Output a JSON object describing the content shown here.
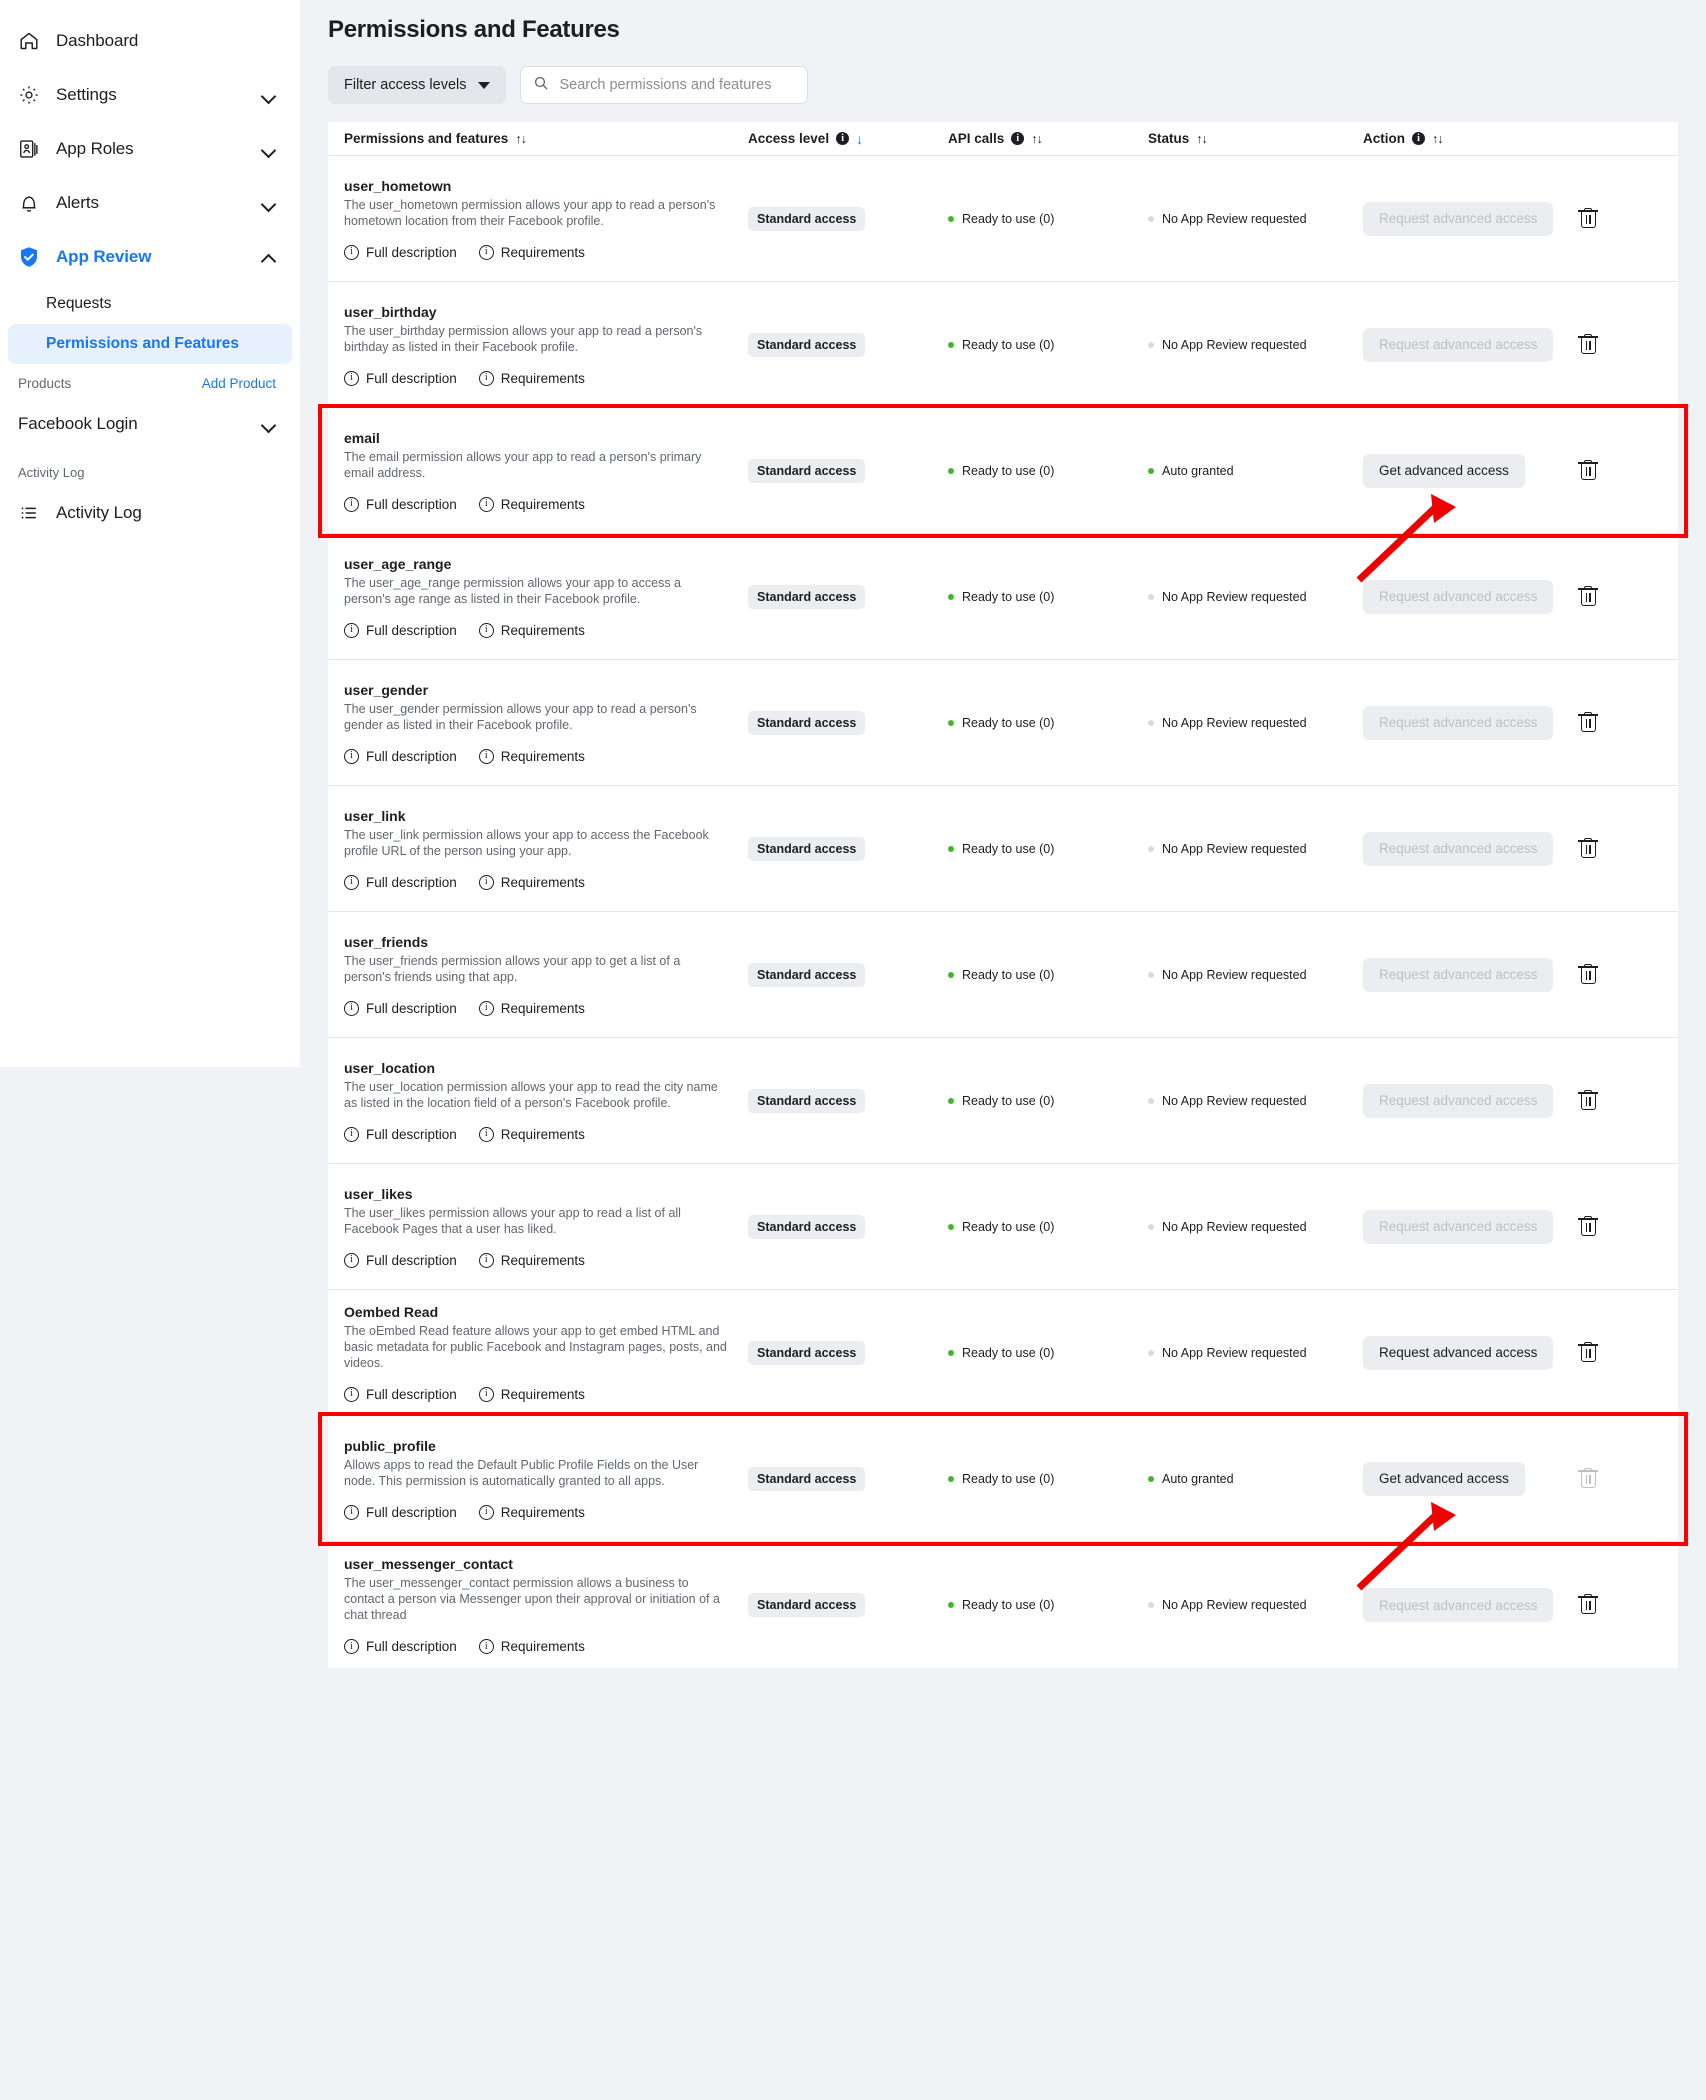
{
  "sidebar": {
    "items": [
      {
        "label": "Dashboard",
        "icon": "home-icon",
        "chevron": "none"
      },
      {
        "label": "Settings",
        "icon": "gear-icon",
        "chevron": "down"
      },
      {
        "label": "App Roles",
        "icon": "app-roles-icon",
        "chevron": "down"
      },
      {
        "label": "Alerts",
        "icon": "bell-icon",
        "chevron": "down"
      },
      {
        "label": "App Review",
        "icon": "shield-check-icon",
        "chevron": "up",
        "active": true
      }
    ],
    "sub_items": [
      {
        "label": "Requests",
        "selected": false
      },
      {
        "label": "Permissions and Features",
        "selected": true
      }
    ],
    "products_label": "Products",
    "add_product_label": "Add Product",
    "product_items": [
      {
        "label": "Facebook Login",
        "chevron": "down"
      }
    ],
    "activity_log_heading": "Activity Log",
    "activity_log_item": {
      "label": "Activity Log",
      "icon": "list-icon"
    }
  },
  "header": {
    "title": "Permissions and Features"
  },
  "toolbar": {
    "filter_label": "Filter access levels",
    "search_placeholder": "Search permissions and features",
    "search_value": ""
  },
  "table": {
    "columns": [
      {
        "label": "Permissions and features",
        "info": false,
        "sort": "updown"
      },
      {
        "label": "Access level",
        "info": true,
        "sort": "down-blue"
      },
      {
        "label": "API calls",
        "info": true,
        "sort": "updown"
      },
      {
        "label": "Status",
        "info": false,
        "sort": "updown"
      },
      {
        "label": "Action",
        "info": true,
        "sort": "updown"
      }
    ],
    "rows": [
      {
        "name": "user_hometown",
        "description": "The user_hometown permission allows your app to read a person's hometown location from their Facebook profile.",
        "access_level": "Standard access",
        "api_calls": "Ready to use (0)",
        "api_dot": "green",
        "status": "No App Review requested",
        "status_dot": "grey",
        "action_label": "Request advanced access",
        "action_enabled": false,
        "trash_enabled": true,
        "highlighted": false
      },
      {
        "name": "user_birthday",
        "description": "The user_birthday permission allows your app to read a person's birthday as listed in their Facebook profile.",
        "access_level": "Standard access",
        "api_calls": "Ready to use (0)",
        "api_dot": "green",
        "status": "No App Review requested",
        "status_dot": "grey",
        "action_label": "Request advanced access",
        "action_enabled": false,
        "trash_enabled": true,
        "highlighted": false
      },
      {
        "name": "email",
        "description": "The email permission allows your app to read a person's primary email address.",
        "access_level": "Standard access",
        "api_calls": "Ready to use (0)",
        "api_dot": "green",
        "status": "Auto granted",
        "status_dot": "green",
        "action_label": "Get advanced access",
        "action_enabled": true,
        "trash_enabled": true,
        "highlighted": true
      },
      {
        "name": "user_age_range",
        "description": "The user_age_range permission allows your app to access a person's age range as listed in their Facebook profile.",
        "access_level": "Standard access",
        "api_calls": "Ready to use (0)",
        "api_dot": "green",
        "status": "No App Review requested",
        "status_dot": "grey",
        "action_label": "Request advanced access",
        "action_enabled": false,
        "trash_enabled": true,
        "highlighted": false
      },
      {
        "name": "user_gender",
        "description": "The user_gender permission allows your app to read a person's gender as listed in their Facebook profile.",
        "access_level": "Standard access",
        "api_calls": "Ready to use (0)",
        "api_dot": "green",
        "status": "No App Review requested",
        "status_dot": "grey",
        "action_label": "Request advanced access",
        "action_enabled": false,
        "trash_enabled": true,
        "highlighted": false
      },
      {
        "name": "user_link",
        "description": "The user_link permission allows your app to access the Facebook profile URL of the person using your app.",
        "access_level": "Standard access",
        "api_calls": "Ready to use (0)",
        "api_dot": "green",
        "status": "No App Review requested",
        "status_dot": "grey",
        "action_label": "Request advanced access",
        "action_enabled": false,
        "trash_enabled": true,
        "highlighted": false
      },
      {
        "name": "user_friends",
        "description": "The user_friends permission allows your app to get a list of a person's friends using that app.",
        "access_level": "Standard access",
        "api_calls": "Ready to use (0)",
        "api_dot": "green",
        "status": "No App Review requested",
        "status_dot": "grey",
        "action_label": "Request advanced access",
        "action_enabled": false,
        "trash_enabled": true,
        "highlighted": false
      },
      {
        "name": "user_location",
        "description": "The user_location permission allows your app to read the city name as listed in the location field of a person's Facebook profile.",
        "access_level": "Standard access",
        "api_calls": "Ready to use (0)",
        "api_dot": "green",
        "status": "No App Review requested",
        "status_dot": "grey",
        "action_label": "Request advanced access",
        "action_enabled": false,
        "trash_enabled": true,
        "highlighted": false
      },
      {
        "name": "user_likes",
        "description": "The user_likes permission allows your app to read a list of all Facebook Pages that a user has liked.",
        "access_level": "Standard access",
        "api_calls": "Ready to use (0)",
        "api_dot": "green",
        "status": "No App Review requested",
        "status_dot": "grey",
        "action_label": "Request advanced access",
        "action_enabled": false,
        "trash_enabled": true,
        "highlighted": false
      },
      {
        "name": "Oembed Read",
        "description": "The oEmbed Read feature allows your app to get embed HTML and basic metadata for public Facebook and Instagram pages, posts, and videos.",
        "access_level": "Standard access",
        "api_calls": "Ready to use (0)",
        "api_dot": "green",
        "status": "No App Review requested",
        "status_dot": "grey",
        "action_label": "Request advanced access",
        "action_enabled": true,
        "trash_enabled": true,
        "highlighted": false
      },
      {
        "name": "public_profile",
        "description": "Allows apps to read the Default Public Profile Fields on the User node. This permission is automatically granted to all apps.",
        "access_level": "Standard access",
        "api_calls": "Ready to use (0)",
        "api_dot": "green",
        "status": "Auto granted",
        "status_dot": "green",
        "action_label": "Get advanced access",
        "action_enabled": true,
        "trash_enabled": false,
        "highlighted": true
      },
      {
        "name": "user_messenger_contact",
        "description": "The user_messenger_contact permission allows a business to contact a person via Messenger upon their approval or initiation of a chat thread",
        "access_level": "Standard access",
        "api_calls": "Ready to use (0)",
        "api_dot": "green",
        "status": "No App Review requested",
        "status_dot": "grey",
        "action_label": "Request advanced access",
        "action_enabled": false,
        "trash_enabled": true,
        "highlighted": false
      }
    ],
    "link_labels": {
      "full_description": "Full description",
      "requirements": "Requirements"
    }
  },
  "annotations": {
    "highlight_color": "#ff0000",
    "arrow_color": "#ee0000",
    "count": 2
  },
  "colors": {
    "accent_blue": "#1877f2",
    "page_bg": "#f0f2f5",
    "panel_bg": "#ffffff",
    "status_green": "#42b72a"
  }
}
